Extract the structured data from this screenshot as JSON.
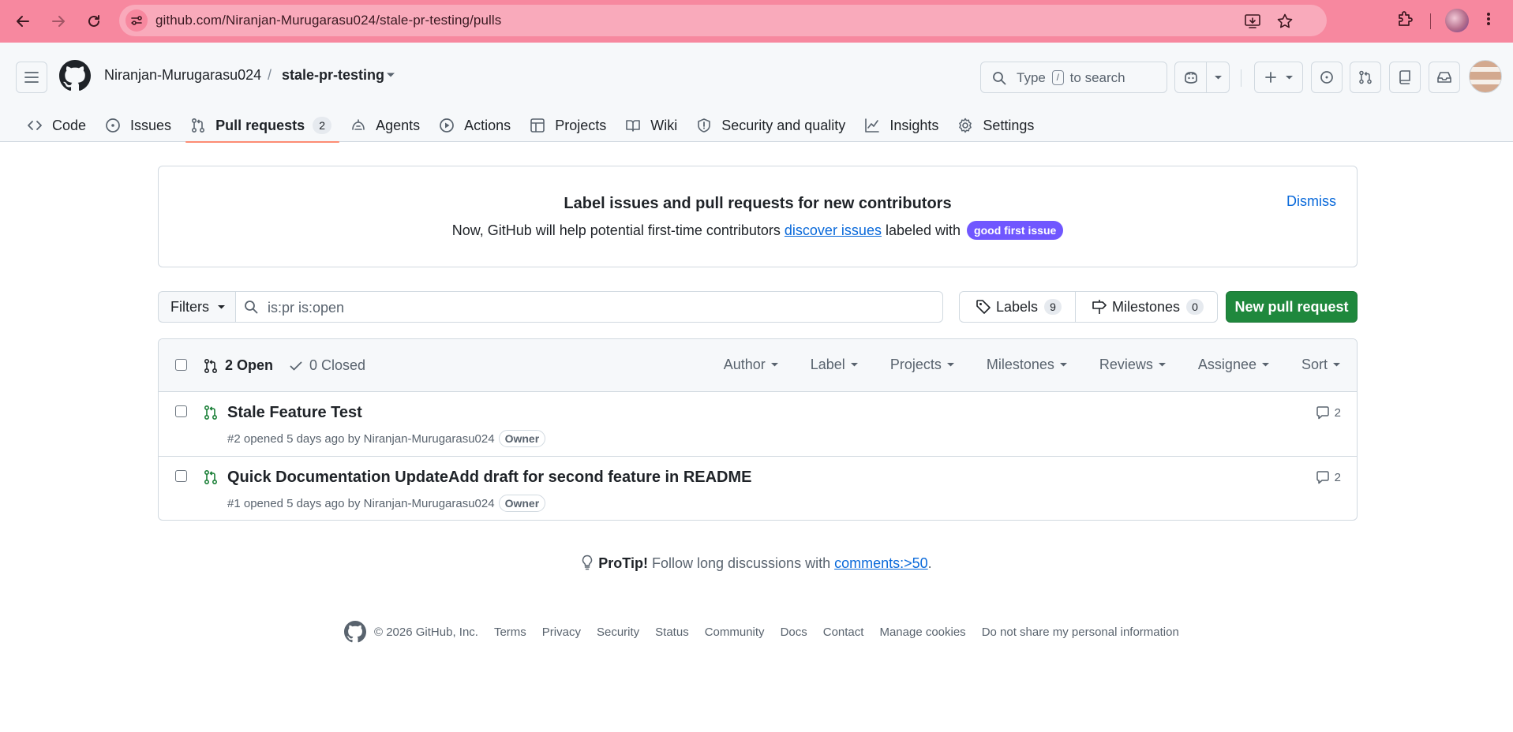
{
  "browser": {
    "url": "github.com/Niranjan-Murugarasu024/stale-pr-testing/pulls"
  },
  "header": {
    "owner": "Niranjan-Murugarasu024",
    "separator": "/",
    "repo": "stale-pr-testing",
    "search": {
      "prefix": "Type",
      "key": "/",
      "suffix": "to search"
    }
  },
  "tabs": [
    {
      "label": "Code",
      "icon": "code-icon"
    },
    {
      "label": "Issues",
      "icon": "issue-opened-icon"
    },
    {
      "label": "Pull requests",
      "icon": "git-pull-request-icon",
      "count": "2",
      "selected": true
    },
    {
      "label": "Agents",
      "icon": "agents-icon"
    },
    {
      "label": "Actions",
      "icon": "play-icon"
    },
    {
      "label": "Projects",
      "icon": "table-icon"
    },
    {
      "label": "Wiki",
      "icon": "book-icon"
    },
    {
      "label": "Security and quality",
      "icon": "shield-icon"
    },
    {
      "label": "Insights",
      "icon": "graph-icon"
    },
    {
      "label": "Settings",
      "icon": "gear-icon"
    }
  ],
  "banner": {
    "title": "Label issues and pull requests for new contributors",
    "body_prefix": "Now, GitHub will help potential first-time contributors",
    "link_text": "discover issues",
    "body_suffix": "labeled with",
    "label": "good first issue",
    "label_color": "#7057ff",
    "dismiss": "Dismiss"
  },
  "filter_bar": {
    "filters_label": "Filters",
    "query": "is:pr is:open",
    "labels_label": "Labels",
    "labels_count": "9",
    "milestones_label": "Milestones",
    "milestones_count": "0",
    "new_pr_label": "New pull request",
    "new_pr_color": "#1f883d"
  },
  "list": {
    "open_label": "2 Open",
    "closed_label": "0 Closed",
    "header_filters": [
      "Author",
      "Label",
      "Projects",
      "Milestones",
      "Reviews",
      "Assignee",
      "Sort"
    ],
    "items": [
      {
        "title": "Stale Feature Test",
        "meta": "#2 opened 5 days ago by",
        "author": "Niranjan-Murugarasu024",
        "badge": "Owner",
        "comments": "2"
      },
      {
        "title": "Quick Documentation UpdateAdd draft for second feature in README",
        "meta": "#1 opened 5 days ago by",
        "author": "Niranjan-Murugarasu024",
        "badge": "Owner",
        "comments": "2"
      }
    ]
  },
  "protip": {
    "lead": "ProTip!",
    "text": "Follow long discussions with",
    "link": "comments:>50",
    "end": "."
  },
  "footer": {
    "copyright": "© 2026 GitHub, Inc.",
    "links": [
      "Terms",
      "Privacy",
      "Security",
      "Status",
      "Community",
      "Docs",
      "Contact",
      "Manage cookies",
      "Do not share my personal information"
    ]
  }
}
